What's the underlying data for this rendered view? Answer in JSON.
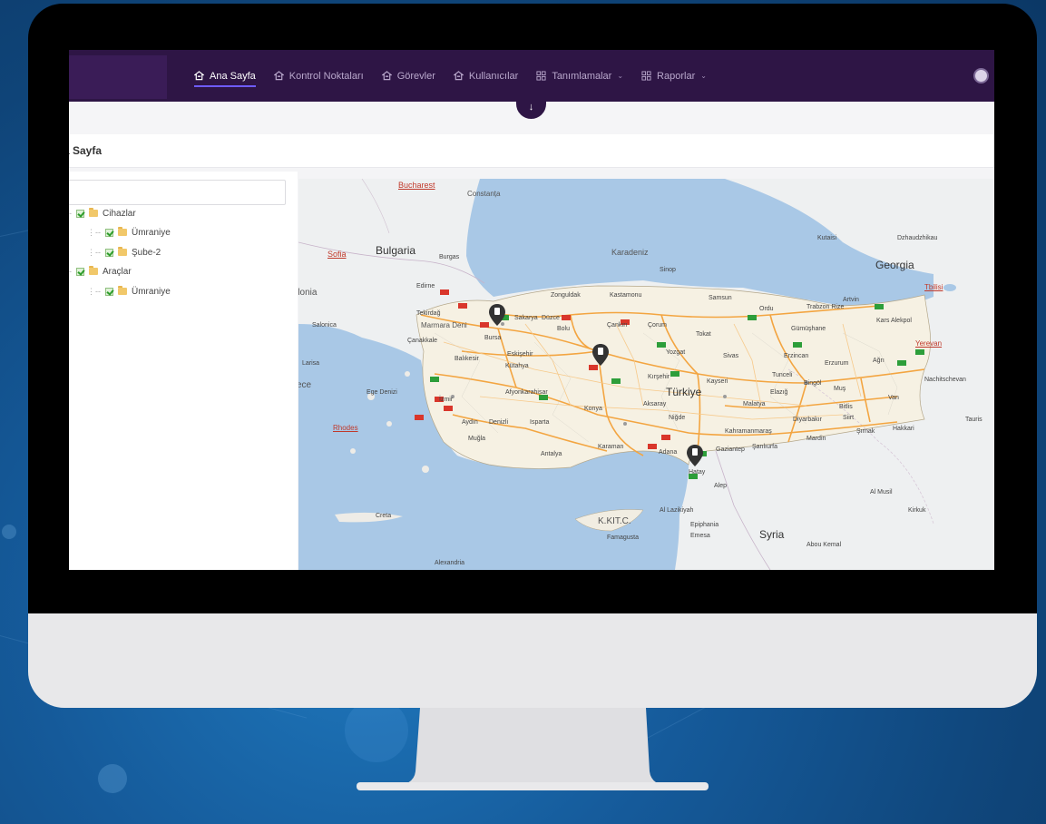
{
  "navbar": {
    "items": [
      {
        "label": "Ana Sayfa",
        "icon": "home-icon",
        "active": true
      },
      {
        "label": "Kontrol Noktaları",
        "icon": "home-icon",
        "active": false
      },
      {
        "label": "Görevler",
        "icon": "home-icon",
        "active": false
      },
      {
        "label": "Kullanıcılar",
        "icon": "home-icon",
        "active": false
      },
      {
        "label": "Tanımlamalar",
        "icon": "grid-icon",
        "active": false,
        "dropdown": true
      },
      {
        "label": "Raporlar",
        "icon": "grid-icon",
        "active": false,
        "dropdown": true
      }
    ],
    "collapse_icon": "arrow-down-icon",
    "avatar_icon": "user-avatar-icon"
  },
  "page": {
    "title": "a Sayfa"
  },
  "tree": {
    "nodes": [
      {
        "label": "Cihazlar",
        "level": 0
      },
      {
        "label": "Ümraniye",
        "level": 1
      },
      {
        "label": "Şube-2",
        "level": 1
      },
      {
        "label": "Araçlar",
        "level": 0
      },
      {
        "label": "Ümraniye",
        "level": 1
      }
    ]
  },
  "map": {
    "country_labels": {
      "bulgaria": "Bulgaria",
      "georgia": "Georgia",
      "turkiye": "Türkiye",
      "syria": "Syria",
      "kktc": "K.KIT.C.",
      "karadeniz": "Karadeniz"
    },
    "link_labels": {
      "bucharest": "Bucharest",
      "sofia": "Sofia",
      "tbilisi": "Tbilisi",
      "yerevan": "Yerevan"
    },
    "city_labels": {
      "constanta": "Constanța",
      "burgas": "Burgas",
      "edirne": "Edirne",
      "tekirdag": "Tekirdağ",
      "marmara": "Marmara Deni",
      "canakkale": "Çanakkale",
      "balikesir": "Balıkesir",
      "bursa": "Bursa",
      "izmir": "İzmir",
      "aydin": "Aydın",
      "mugla": "Muğla",
      "denizli": "Denizli",
      "isparta": "Isparta",
      "antalya": "Antalya",
      "zonguldak": "Zonguldak",
      "kastamonu": "Kastamonu",
      "sinop": "Sinop",
      "samsun": "Samsun",
      "ordu": "Ordu",
      "trabzon": "Trabzon Rize",
      "artvin": "Artvin",
      "kars": "Kars Alekpol",
      "gumushane": "Gümüşhane",
      "erzurum": "Erzurum",
      "erzincan": "Erzincan",
      "agri": "Ağrı",
      "tokat": "Tokat",
      "yozgat": "Yozgat",
      "sivas": "Sivas",
      "corum": "Çorum",
      "cankiri": "Çankırı",
      "eskisehir": "Eskişehir",
      "kutahya": "Kütahya",
      "afyon": "Afyonkarahisar",
      "aksaray": "Aksaray",
      "nigde": "Niğde",
      "konya": "Konya",
      "karaman": "Karaman",
      "adana": "Adana",
      "gaziantep": "Gaziantep",
      "sanliurfa": "Şanlıurfa",
      "mardin": "Mardin",
      "diyarbakir": "Diyarbakır",
      "malatya": "Malatya",
      "tunceli": "Tunceli",
      "bingol": "Bingöl",
      "mus": "Muş",
      "van": "Van",
      "siirt": "Siirt",
      "hakkari": "Hakkari",
      "kahramanmaras": "Kahramanmaraş",
      "hatay": "Hatay",
      "alep": "Alep",
      "latakia": "Al Lazikiyah",
      "epiphania": "Epiphania",
      "emesa": "Emesa",
      "famagusta": "Famagusta",
      "abou_kemal": "Abou Kemal",
      "al_musil": "Al Musil",
      "kirkuk": "Kirkuk",
      "tauris": "Tauris",
      "nachitschevan": "Nachitschevan",
      "dzhaudzhikau": "Dzhaudzhikau",
      "kutaisi": "Kutaisi",
      "larisa": "Larisa",
      "salonica": "Salonica",
      "creta": "Creta",
      "rhodes": "Rhodes",
      "alexandria": "Alexandria",
      "donia": "donia",
      "ece": "ece",
      "ege": "Ege Denizi",
      "sirnak": "Şırnak",
      "bolu": "Bolu",
      "sakarya": "Sakarya",
      "duzce": "Düzce",
      "kirsehir": "Kırşehir",
      "elazig": "Elazığ",
      "bitlis": "Bitlis",
      "kayseri": "Kayseri"
    },
    "markers": [
      {
        "name": "istanbul-marker",
        "icon": "map-pin-icon"
      },
      {
        "name": "ankara-marker",
        "icon": "map-pin-icon"
      },
      {
        "name": "adana-marker",
        "icon": "map-pin-icon"
      }
    ]
  }
}
